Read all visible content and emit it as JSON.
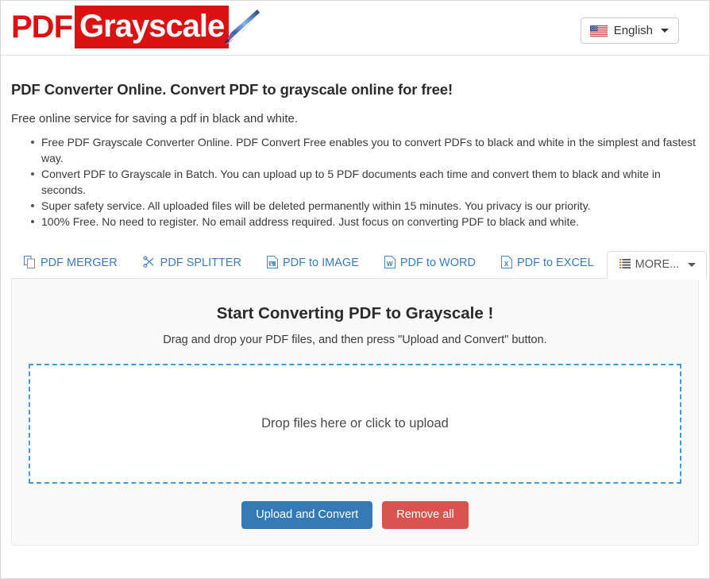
{
  "header": {
    "logo_pdf": "PDF",
    "logo_grayscale": "Grayscale",
    "logo_brush_icon": "paintbrush-icon",
    "language": {
      "label": "English",
      "flag_icon": "us-flag-icon",
      "caret_icon": "chevron-down-icon"
    }
  },
  "intro": {
    "title": "PDF Converter Online. Convert PDF to grayscale online for free!",
    "subtitle": "Free online service for saving a pdf in black and white.",
    "features": [
      "Free PDF Grayscale Converter Online. PDF Convert Free enables you to convert PDFs to black and white in the simplest and fastest way.",
      "Convert PDF to Grayscale in Batch. You can upload up to 5 PDF documents each time and convert them to black and white in seconds.",
      "Super safety service. All uploaded files will be deleted permanently within 15 minutes. You privacy is our priority.",
      "100% Free. No need to register. No email address required. Just focus on converting PDF to black and white."
    ]
  },
  "tabs": [
    {
      "label": "PDF MERGER",
      "icon": "copy-pages-icon",
      "active": false
    },
    {
      "label": "PDF SPLITTER",
      "icon": "scissors-icon",
      "active": false
    },
    {
      "label": "PDF to IMAGE",
      "icon": "image-file-icon",
      "active": false
    },
    {
      "label": "PDF to WORD",
      "icon": "word-file-icon",
      "active": false
    },
    {
      "label": "PDF to EXCEL",
      "icon": "excel-file-icon",
      "active": false
    },
    {
      "label": "MORE...",
      "icon": "list-icon",
      "active": true
    }
  ],
  "main": {
    "heading": "Start Converting PDF to Grayscale !",
    "instructions": "Drag and drop your PDF files, and then press \"Upload and Convert\" button.",
    "dropzone_label": "Drop files here or click to upload",
    "buttons": {
      "upload": "Upload and Convert",
      "remove": "Remove all"
    }
  },
  "colors": {
    "brand_red": "#dd1111",
    "tab_link_blue": "#3a7bbf",
    "dropzone_blue": "#3d9ae8",
    "primary_button": "#337ab7",
    "danger_button": "#d9534f",
    "panel_background": "#f9f9f9"
  }
}
